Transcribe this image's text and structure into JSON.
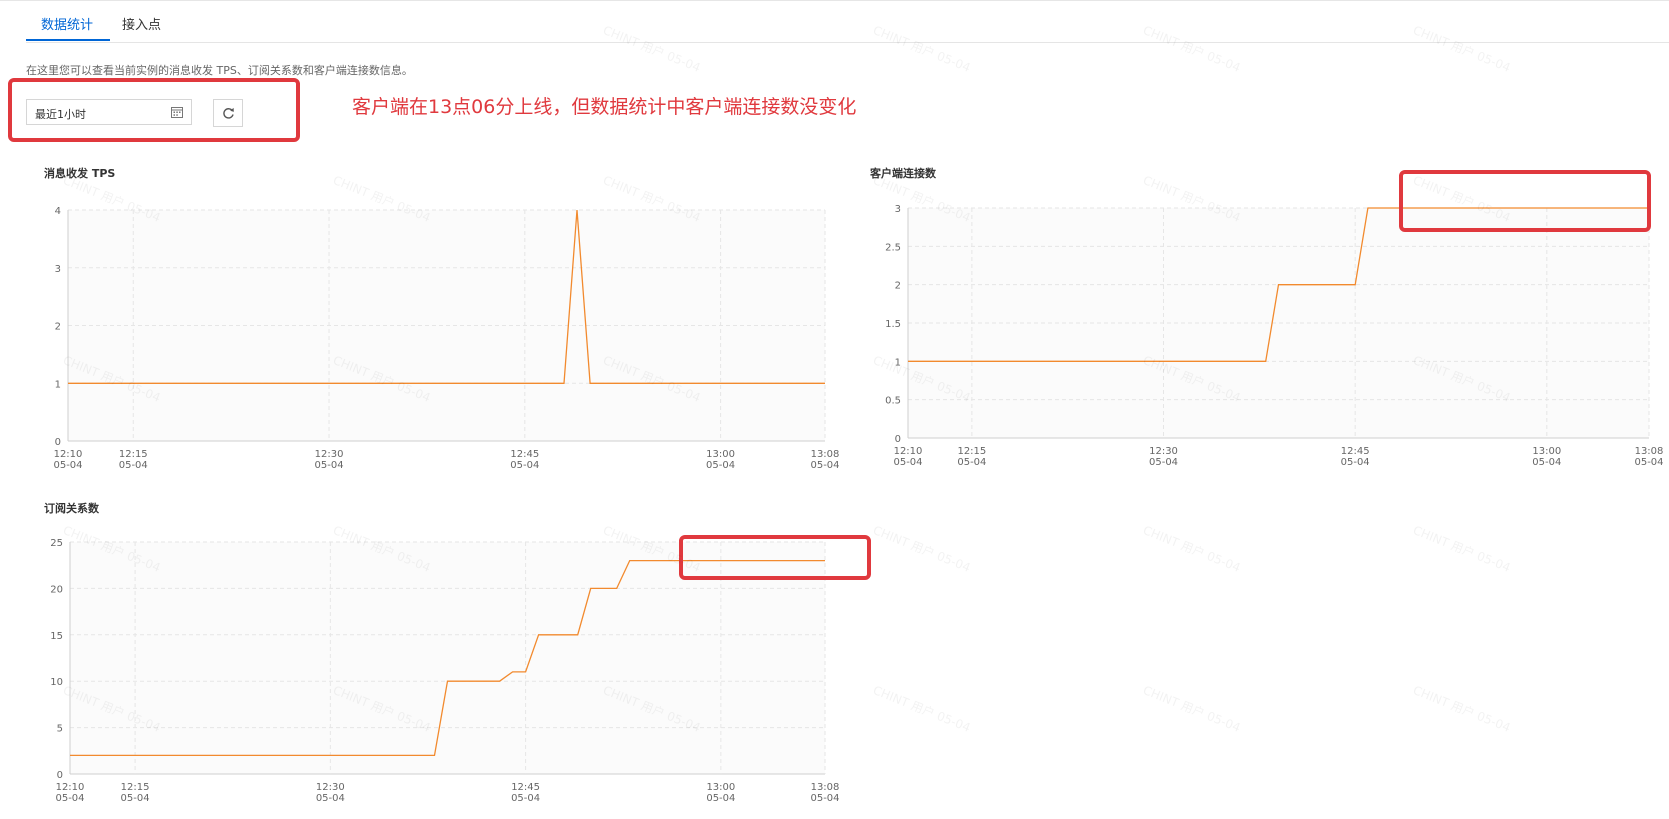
{
  "tabs": [
    {
      "label": "数据统计",
      "active": true
    },
    {
      "label": "接入点",
      "active": false
    }
  ],
  "description": "在这里您可以查看当前实例的消息收发 TPS、订阅关系数和客户端连接数信息。",
  "time_picker": {
    "value": "最近1小时",
    "icon": "calendar-icon"
  },
  "refresh_icon": "refresh-icon",
  "annotation": {
    "text": "客户端在13点06分上线，但数据统计中客户端连接数没变化",
    "color": "#e0393e"
  },
  "watermark": "CHINT 用户 05-04",
  "line_color": "#f28a2e",
  "chart_data": [
    {
      "type": "line",
      "title": "消息收发 TPS",
      "x_ticks": [
        {
          "time": "12:10",
          "date": "05-04"
        },
        {
          "time": "12:15",
          "date": "05-04"
        },
        {
          "time": "12:30",
          "date": "05-04"
        },
        {
          "time": "12:45",
          "date": "05-04"
        },
        {
          "time": "13:00",
          "date": "05-04"
        },
        {
          "time": "13:08",
          "date": "05-04"
        }
      ],
      "y_ticks": [
        "0",
        "1",
        "2",
        "3",
        "4"
      ],
      "ylim": [
        0,
        4
      ],
      "xlim": [
        "12:10",
        "13:08"
      ],
      "grid": true,
      "series": [
        {
          "x": [
            "12:10",
            "12:48",
            "12:49",
            "12:50",
            "13:08"
          ],
          "y": [
            1,
            1,
            4,
            1,
            1
          ]
        }
      ]
    },
    {
      "type": "line",
      "title": "客户端连接数",
      "x_ticks": [
        {
          "time": "12:10",
          "date": "05-04"
        },
        {
          "time": "12:15",
          "date": "05-04"
        },
        {
          "time": "12:30",
          "date": "05-04"
        },
        {
          "time": "12:45",
          "date": "05-04"
        },
        {
          "time": "13:00",
          "date": "05-04"
        },
        {
          "time": "13:08",
          "date": "05-04"
        }
      ],
      "y_ticks": [
        "0",
        "0.5",
        "1",
        "1.5",
        "2",
        "2.5",
        "3"
      ],
      "ylim": [
        0,
        3
      ],
      "xlim": [
        "12:10",
        "13:08"
      ],
      "grid": true,
      "series": [
        {
          "x": [
            "12:10",
            "12:38",
            "12:39",
            "12:45",
            "12:46",
            "13:08"
          ],
          "y": [
            1,
            1,
            2,
            2,
            3,
            3
          ]
        }
      ]
    },
    {
      "type": "line",
      "title": "订阅关系数",
      "x_ticks": [
        {
          "time": "12:10",
          "date": "05-04"
        },
        {
          "time": "12:15",
          "date": "05-04"
        },
        {
          "time": "12:30",
          "date": "05-04"
        },
        {
          "time": "12:45",
          "date": "05-04"
        },
        {
          "time": "13:00",
          "date": "05-04"
        },
        {
          "time": "13:08",
          "date": "05-04"
        }
      ],
      "y_ticks": [
        "0",
        "5",
        "10",
        "15",
        "20",
        "25"
      ],
      "ylim": [
        0,
        25
      ],
      "xlim": [
        "12:10",
        "13:08"
      ],
      "grid": true,
      "series": [
        {
          "x": [
            "12:10",
            "12:38",
            "12:39",
            "12:43",
            "12:44",
            "12:45",
            "12:46",
            "12:49",
            "12:50",
            "12:52",
            "12:53",
            "13:08"
          ],
          "y": [
            2,
            2,
            10,
            10,
            11,
            11,
            15,
            15,
            20,
            20,
            23,
            23
          ]
        }
      ]
    }
  ]
}
